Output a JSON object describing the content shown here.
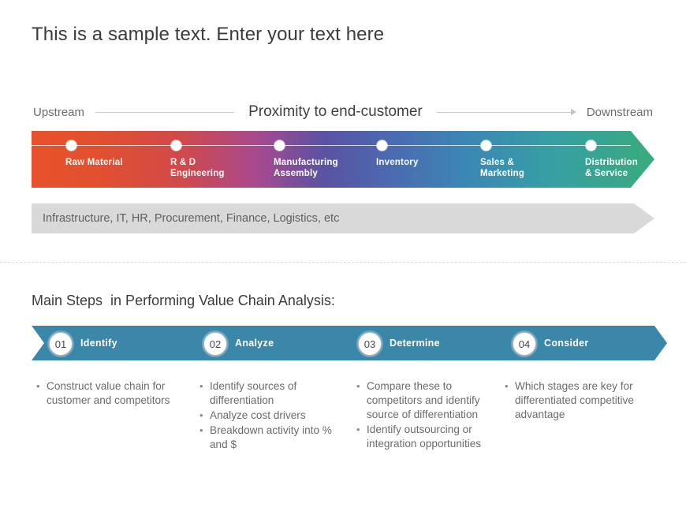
{
  "slide": {
    "title": "This is a sample text. Enter your text here"
  },
  "proximity": {
    "upstream_label": "Upstream",
    "center_label": "Proximity to end-customer",
    "downstream_label": "Downstream"
  },
  "value_chain": {
    "gradient_start_color": "#e8522b",
    "gradient_end_color": "#3aab7d",
    "stages": [
      {
        "label_line1": "Raw Material",
        "label_line2": ""
      },
      {
        "label_line1": "R & D",
        "label_line2": "Engineering"
      },
      {
        "label_line1": "Manufacturing",
        "label_line2": "Assembly"
      },
      {
        "label_line1": "Inventory",
        "label_line2": ""
      },
      {
        "label_line1": "Sales &",
        "label_line2": "Marketing"
      },
      {
        "label_line1": "Distribution",
        "label_line2": "& Service"
      }
    ]
  },
  "support_bar": {
    "text": "Infrastructure, IT, HR, Procurement, Finance, Logistics, etc",
    "color": "#d9d9d9"
  },
  "steps_section": {
    "heading": "Main Steps  in Performing Value Chain Analysis:",
    "chevron_color": "#3b87aa",
    "steps": [
      {
        "number": "01",
        "label": "Identify"
      },
      {
        "number": "02",
        "label": "Analyze"
      },
      {
        "number": "03",
        "label": "Determine"
      },
      {
        "number": "04",
        "label": "Consider"
      }
    ],
    "columns": [
      {
        "bullets": [
          "Construct value chain for customer and competitors"
        ]
      },
      {
        "bullets": [
          "Identify sources of differentiation",
          "Analyze cost drivers",
          "Breakdown activity into % and $"
        ]
      },
      {
        "bullets": [
          "Compare these to competitors and identify source of differentiation",
          "Identify outsourcing or integration opportunities"
        ]
      },
      {
        "bullets": [
          "Which stages are key for differentiated competitive advantage"
        ]
      }
    ],
    "bullet_glyph": "•"
  }
}
